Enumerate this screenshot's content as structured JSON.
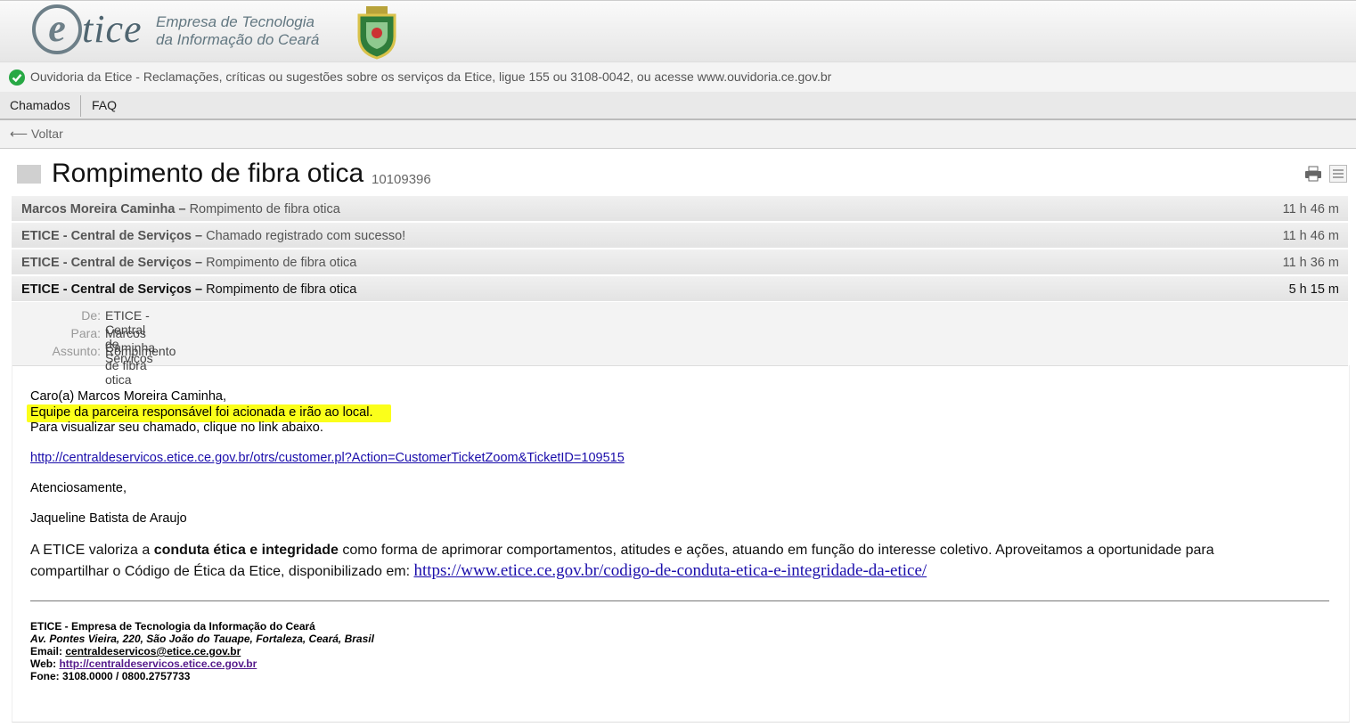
{
  "header": {
    "logo_e": "e",
    "logo_tice": "tice",
    "logo_line1": "Empresa de Tecnologia",
    "logo_line2": "da Informação do Ceará"
  },
  "ouvidoria": {
    "text": "Ouvidoria da Etice - Reclamações, críticas ou sugestões sobre os serviços da Etice, ligue 155 ou 3108-0042, ou acesse www.ouvidoria.ce.gov.br"
  },
  "menu": {
    "items": [
      "Chamados",
      "FAQ"
    ]
  },
  "back": {
    "label": "⟵ Voltar"
  },
  "ticket": {
    "title": "Rompimento de fibra otica",
    "number": "10109396"
  },
  "articles": [
    {
      "from": "Marcos Moreira Caminha –",
      "subject": " Rompimento de fibra otica",
      "age": "11 h 46 m"
    },
    {
      "from": "ETICE - Central de Serviços –",
      "subject": " Chamado registrado com sucesso!",
      "age": "11 h 46 m"
    },
    {
      "from": "ETICE - Central de Serviços –",
      "subject": " Rompimento de fibra otica",
      "age": "11 h 36 m"
    },
    {
      "from": "ETICE - Central de Serviços –",
      "subject": " Rompimento de fibra otica",
      "age": "5 h 15 m"
    }
  ],
  "open_article": {
    "labels": {
      "from": "De:",
      "to": "Para:",
      "subject": "Assunto:"
    },
    "from": "ETICE - Central de Serviços",
    "to": "Marcos Caminha",
    "subject": "Rompimento de fibra otica"
  },
  "mail": {
    "greeting": "Caro(a) Marcos Moreira Caminha,",
    "highlight": "Equipe da parceira responsável foi acionada e irão ao local.",
    "instruction": "Para visualizar seu chamado, clique no link abaixo.",
    "ticket_link": "http://centraldeservicos.etice.ce.gov.br/otrs/customer.pl?Action=CustomerTicketZoom&TicketID=109515",
    "closing": "Atenciosamente,",
    "agent": "Jaqueline Batista de Araujo",
    "ethic_1": "A ETICE valoriza a ",
    "ethic_bold": "conduta ética e integridade",
    "ethic_2": " como forma de aprimorar comportamentos, atitudes e ações, atuando em função do interesse coletivo.  Aproveitamos a oportunidade para compartilhar o Código de Ética da Etice, disponibilizado em:  ",
    "ethic_link": "https://www.etice.ce.gov.br/codigo-de-conduta-etica-e-integridade-da-etice/"
  },
  "signature": {
    "company": "ETICE - Empresa de Tecnologia da Informação do Ceará",
    "address": "Av. Pontes Vieira, 220, São João do Tauape, Fortaleza, Ceará, Brasil",
    "email_label": "Email: ",
    "email": "centraldeservicos@etice.ce.gov.br",
    "web_label": "Web: ",
    "web": "http://centraldeservicos.etice.ce.gov.br",
    "phone": "Fone: 3108.0000 / 0800.2757733"
  }
}
